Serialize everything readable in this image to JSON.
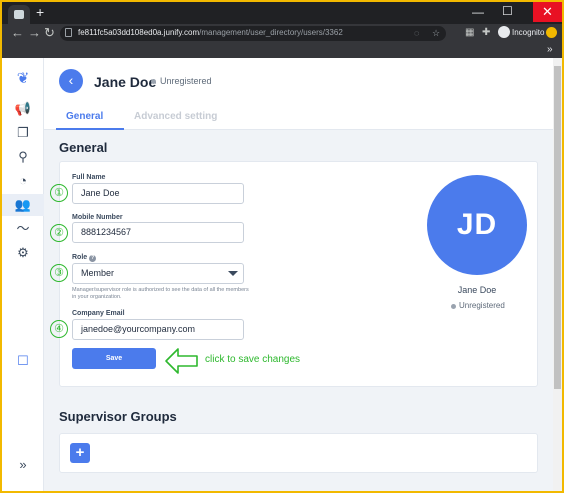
{
  "browser": {
    "url_host": "fe811fc5a03dd108ed0a.junify.com",
    "url_path": "/management/user_directory/users/3362",
    "incognito_label": "Incognito",
    "new_tab": "+",
    "bookmarks_more": "»"
  },
  "header": {
    "user_name": "Jane Doe",
    "status": "Unregistered",
    "tabs": [
      {
        "label": "General"
      },
      {
        "label": "Advanced setting"
      }
    ]
  },
  "general": {
    "title": "General",
    "full_name": {
      "label": "Full Name",
      "value": "Jane Doe"
    },
    "mobile_number": {
      "label": "Mobile Number",
      "value": "8881234567"
    },
    "role": {
      "label": "Role",
      "value": "Member",
      "description": "Manager/supervisor role is authorized to see the data of all the members in your organization."
    },
    "company_email": {
      "label": "Company Email",
      "value": "janedoe@yourcompany.com"
    },
    "save_label": "Save"
  },
  "profile": {
    "initials": "JD",
    "name": "Jane Doe",
    "status": "Unregistered",
    "avatar_color": "#4b7bec"
  },
  "annotations": {
    "numbers": [
      "①",
      "②",
      "③",
      "④"
    ],
    "hint": "click to save changes",
    "color": "#2eb82e"
  },
  "supervisor_groups": {
    "title": "Supervisor Groups",
    "add_label": "+"
  },
  "sidebar": {
    "icons": [
      "leaf-logo-icon",
      "megaphone-icon",
      "cards-icon",
      "location-pin-icon",
      "stopwatch-icon",
      "users-icon",
      "activity-icon",
      "gear-icon",
      "chat-icon",
      "expand-icon"
    ],
    "active": "users-icon"
  },
  "colors": {
    "accent": "#4b7bec"
  }
}
